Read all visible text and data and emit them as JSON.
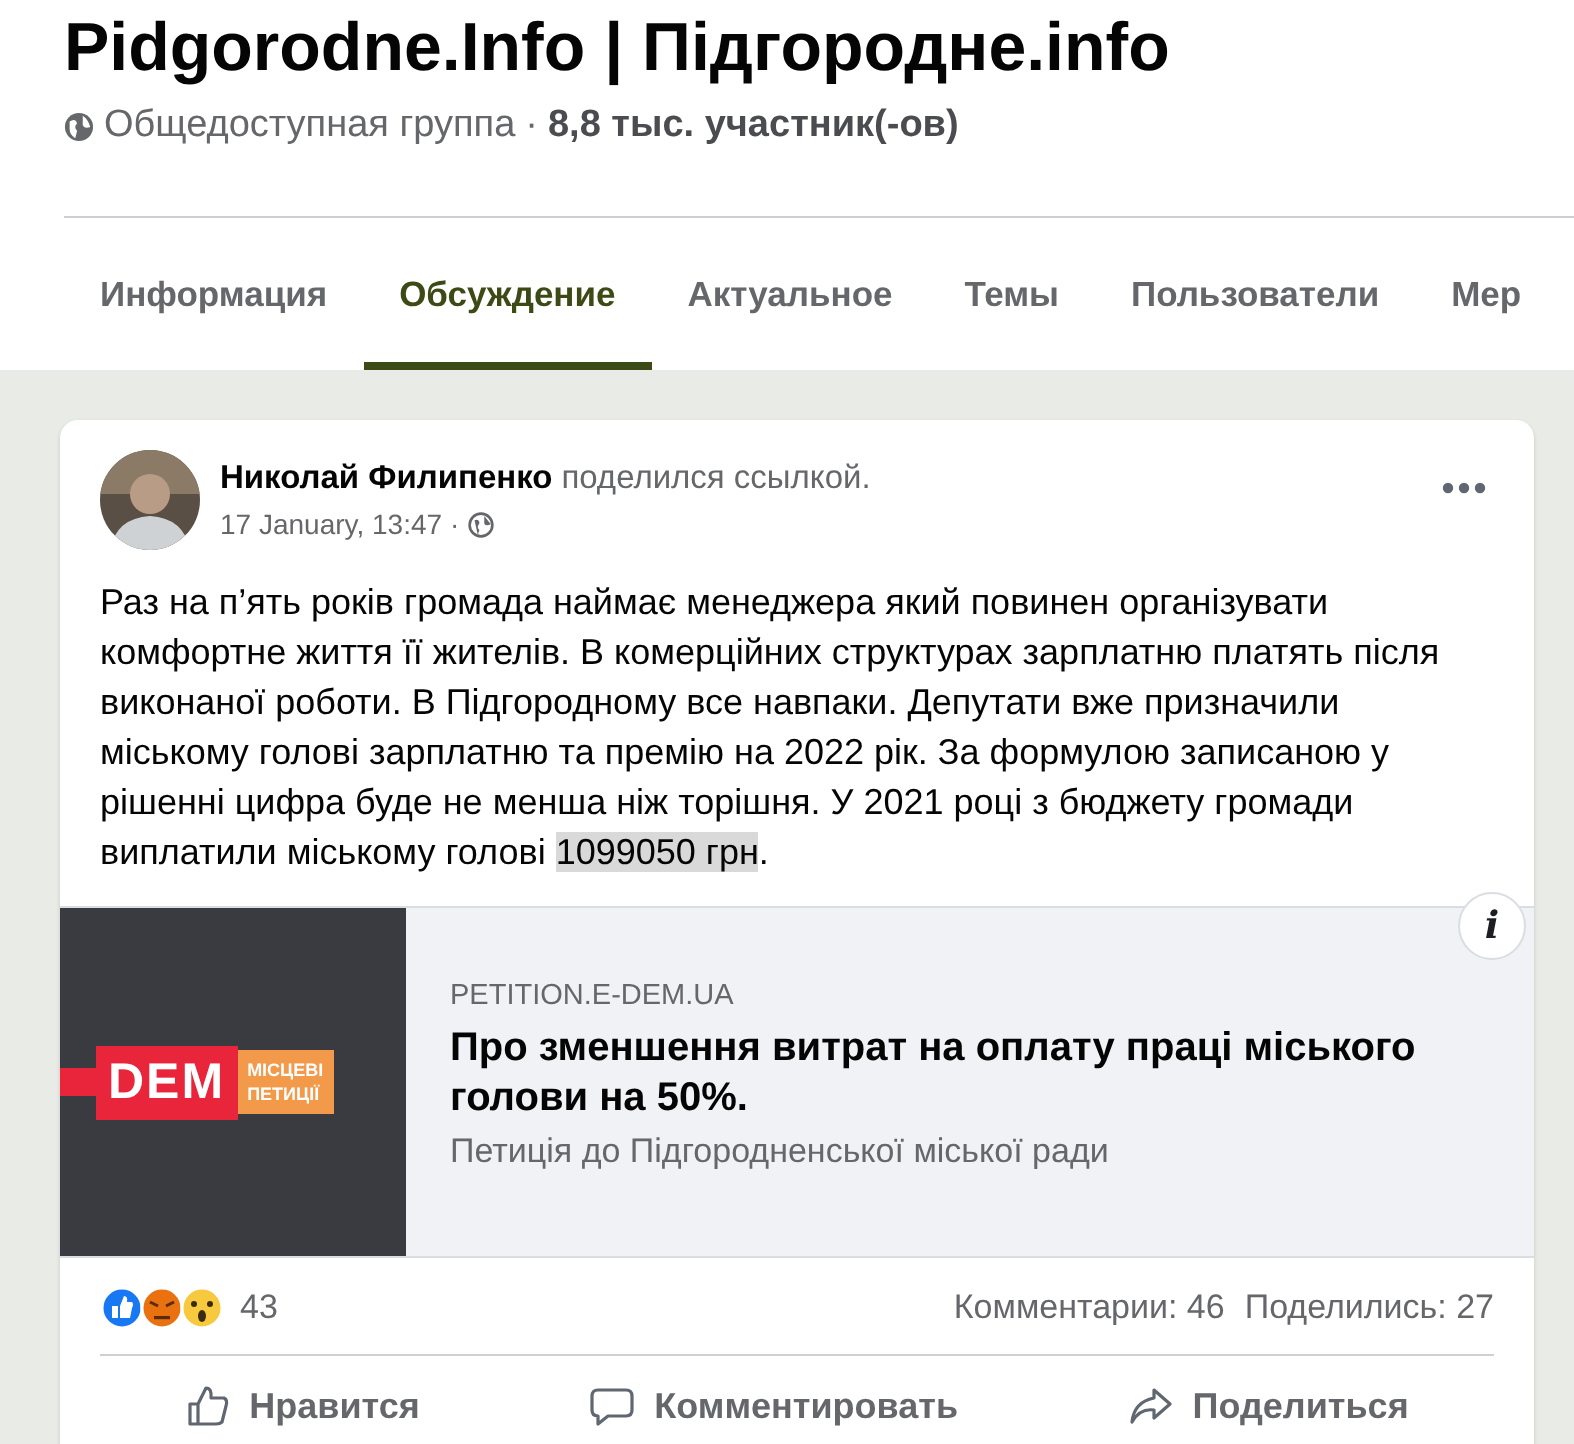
{
  "group": {
    "title": "Pidgorodne.Info | Підгородне.info",
    "privacy": "Общедоступная группа",
    "separator": "·",
    "members": "8,8 тыс. участник(-ов)"
  },
  "tabs": [
    {
      "label": "Информация",
      "selected": false
    },
    {
      "label": "Обсуждение",
      "selected": true
    },
    {
      "label": "Актуальное",
      "selected": false
    },
    {
      "label": "Темы",
      "selected": false
    },
    {
      "label": "Пользователи",
      "selected": false
    },
    {
      "label": "Мер",
      "selected": false
    }
  ],
  "post": {
    "author": "Николай Филипенко",
    "action": "поделился ссылкой.",
    "time": "17 January, 13:47",
    "time_separator": "·",
    "text": "Раз на п’ять років громада наймає менеджера який повинен організувати комфортне життя її жителів. В комерційних структурах зарплатню платять після виконаної роботи. В Підгородному все навпаки. Депутати вже призначили міському голові зарплатню та премію на 2022 рік. За формулою записаною у рішенні цифра буде не менша ніж торішня. У 2021 році з бюджету громади виплатили міському голові ",
    "highlighted": "1099050 грн",
    "text_end": ".",
    "link": {
      "logo_main": "DEM",
      "logo_side": [
        "МІСЦЕВІ",
        "ПЕТИЦІЇ"
      ],
      "domain": "PETITION.E-DEM.UA",
      "title": "Про зменшення витрат на оплату праці міського голови на 50%.",
      "description": "Петиція до Підгородненської міської ради",
      "info": "i"
    },
    "reactions": {
      "count": "43",
      "comments": "Комментарии: 46",
      "shares": "Поделились: 27"
    },
    "actions": [
      {
        "kind": "like",
        "label": "Нравится"
      },
      {
        "kind": "comment",
        "label": "Комментировать"
      },
      {
        "kind": "share",
        "label": "Поделиться"
      }
    ]
  }
}
